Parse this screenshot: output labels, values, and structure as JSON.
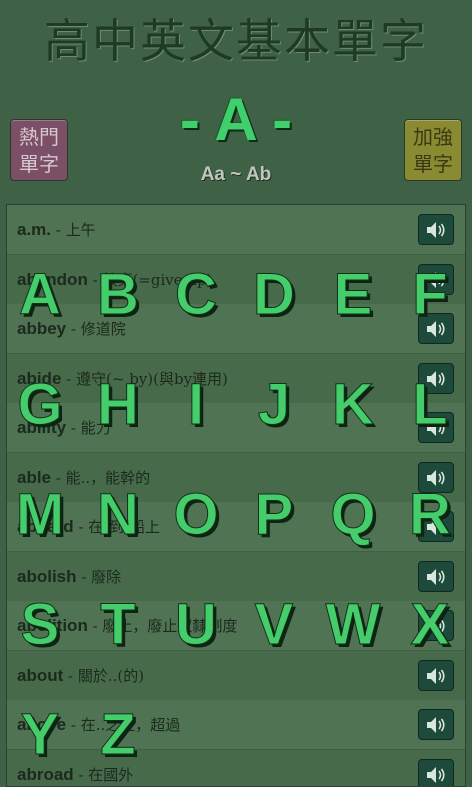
{
  "app_title": "高中英文基本單字",
  "current_letter": "- A -",
  "range_label": "Aa ~ Ab",
  "buttons": {
    "popular": [
      "熱門",
      "單字"
    ],
    "advanced": [
      "加強",
      "單字"
    ]
  },
  "words": [
    {
      "en": "a.m.",
      "zh": " - 上午"
    },
    {
      "en": "abandon",
      "zh": " - 放棄(=give up)"
    },
    {
      "en": "abbey",
      "zh": " - 修道院"
    },
    {
      "en": "abide",
      "zh": " - 遵守(~ by)(與by連用)"
    },
    {
      "en": "ability",
      "zh": " - 能力"
    },
    {
      "en": "able",
      "zh": " - 能..，能幹的"
    },
    {
      "en": "aboard",
      "zh": " - 在[到]船上"
    },
    {
      "en": "abolish",
      "zh": " - 廢除"
    },
    {
      "en": "abolition",
      "zh": " - 廢止，廢止奴隸制度"
    },
    {
      "en": "about",
      "zh": " - 關於..(的)"
    },
    {
      "en": "above",
      "zh": " - 在..之上，超過"
    },
    {
      "en": "abroad",
      "zh": " - 在國外"
    }
  ],
  "alphabet": [
    "A",
    "B",
    "C",
    "D",
    "E",
    "F",
    "G",
    "H",
    "I",
    "J",
    "K",
    "L",
    "M",
    "N",
    "O",
    "P",
    "Q",
    "R",
    "S",
    "T",
    "U",
    "V",
    "W",
    "X",
    "Y",
    "Z"
  ],
  "icons": {
    "speaker": "speaker-icon"
  }
}
